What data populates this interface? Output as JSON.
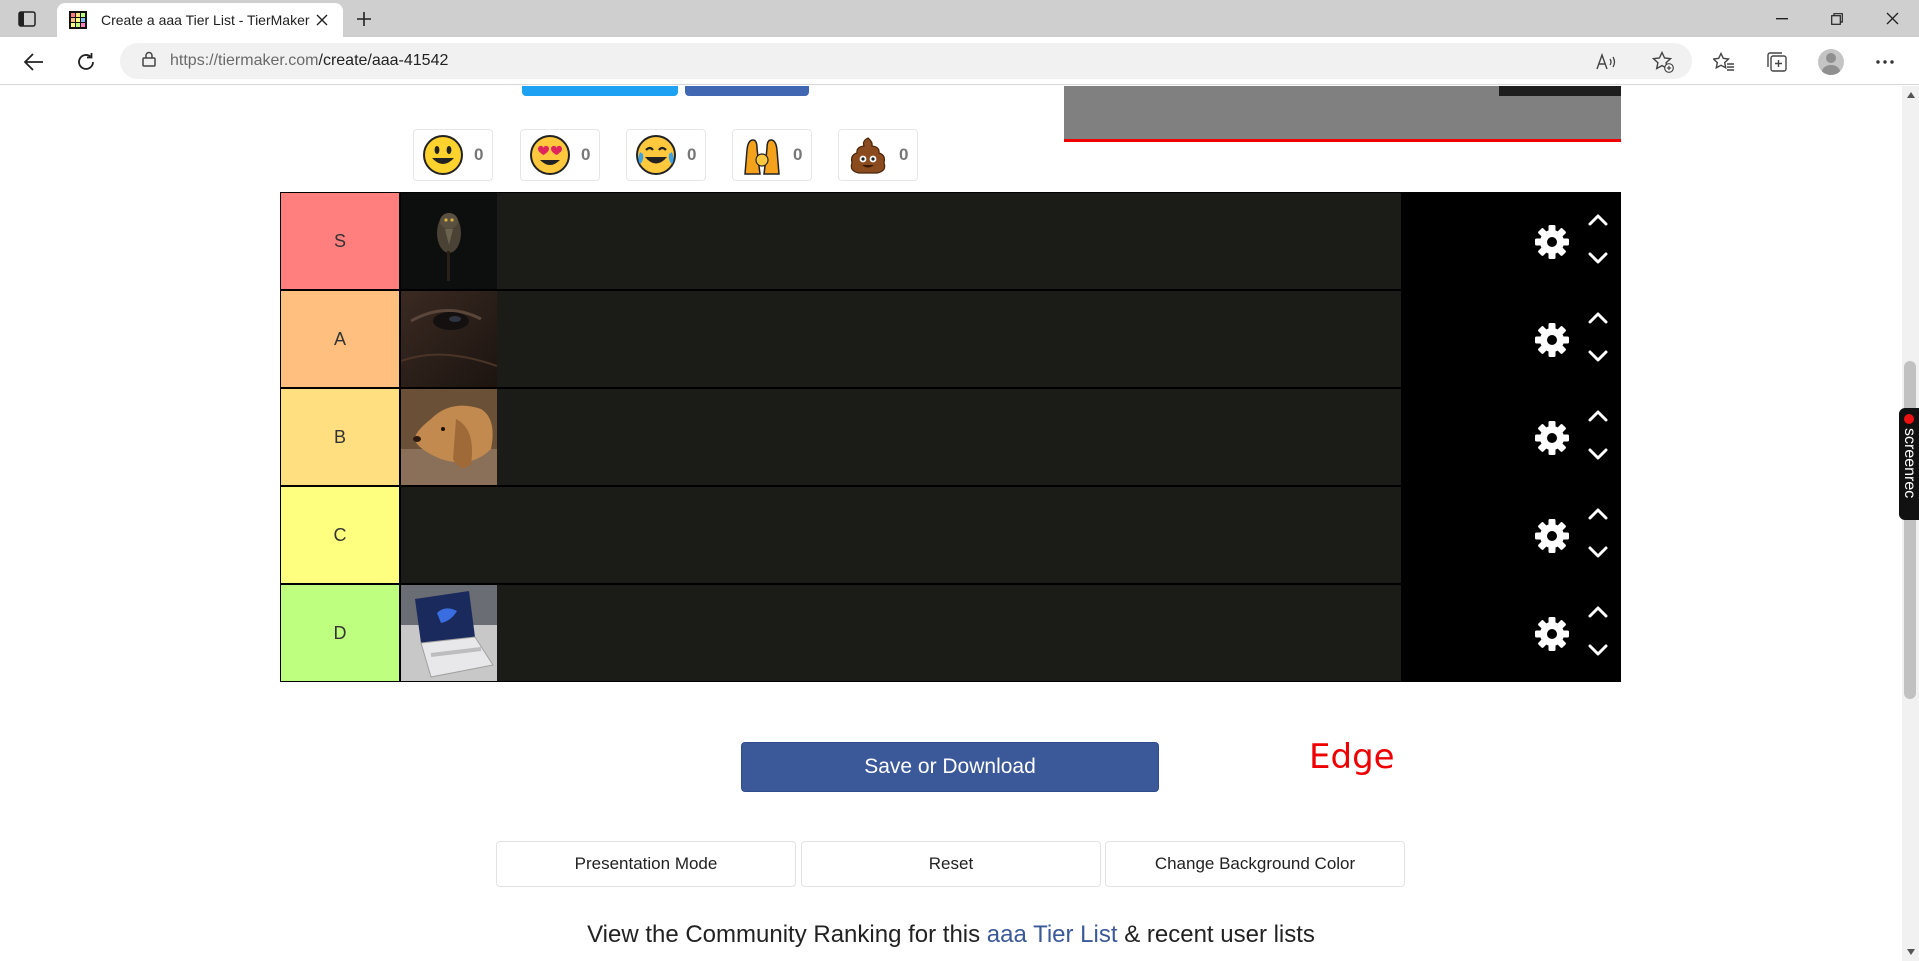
{
  "browser": {
    "tab_title": "Create a aaa Tier List - TierMaker",
    "url_host": "https://tiermaker.com",
    "url_path": "/create/aaa-41542"
  },
  "reactions": [
    {
      "emoji": "grinning-face",
      "count": "0"
    },
    {
      "emoji": "heart-eyes-face",
      "count": "0"
    },
    {
      "emoji": "tears-of-joy-face",
      "count": "0"
    },
    {
      "emoji": "raising-hands",
      "count": "0"
    },
    {
      "emoji": "pile-of-poo",
      "count": "0"
    }
  ],
  "tiers": [
    {
      "label": "S",
      "color": "#ff7f7f",
      "item": "owl-photo"
    },
    {
      "label": "A",
      "color": "#ffbf7f",
      "item": "horse-eye-photo"
    },
    {
      "label": "B",
      "color": "#ffdf7f",
      "item": "dog-photo"
    },
    {
      "label": "C",
      "color": "#ffff7f",
      "item": ""
    },
    {
      "label": "D",
      "color": "#bfff7f",
      "item": "laptop-photo"
    }
  ],
  "save_button": "Save or Download",
  "annotation": "Edge",
  "actions": {
    "presentation": "Presentation Mode",
    "reset": "Reset",
    "change_bg": "Change Background Color"
  },
  "community": {
    "prefix": "View the Community Ranking for this ",
    "link": "aaa Tier List",
    "suffix": " & recent user lists"
  },
  "screenrec_label": "screenrec"
}
